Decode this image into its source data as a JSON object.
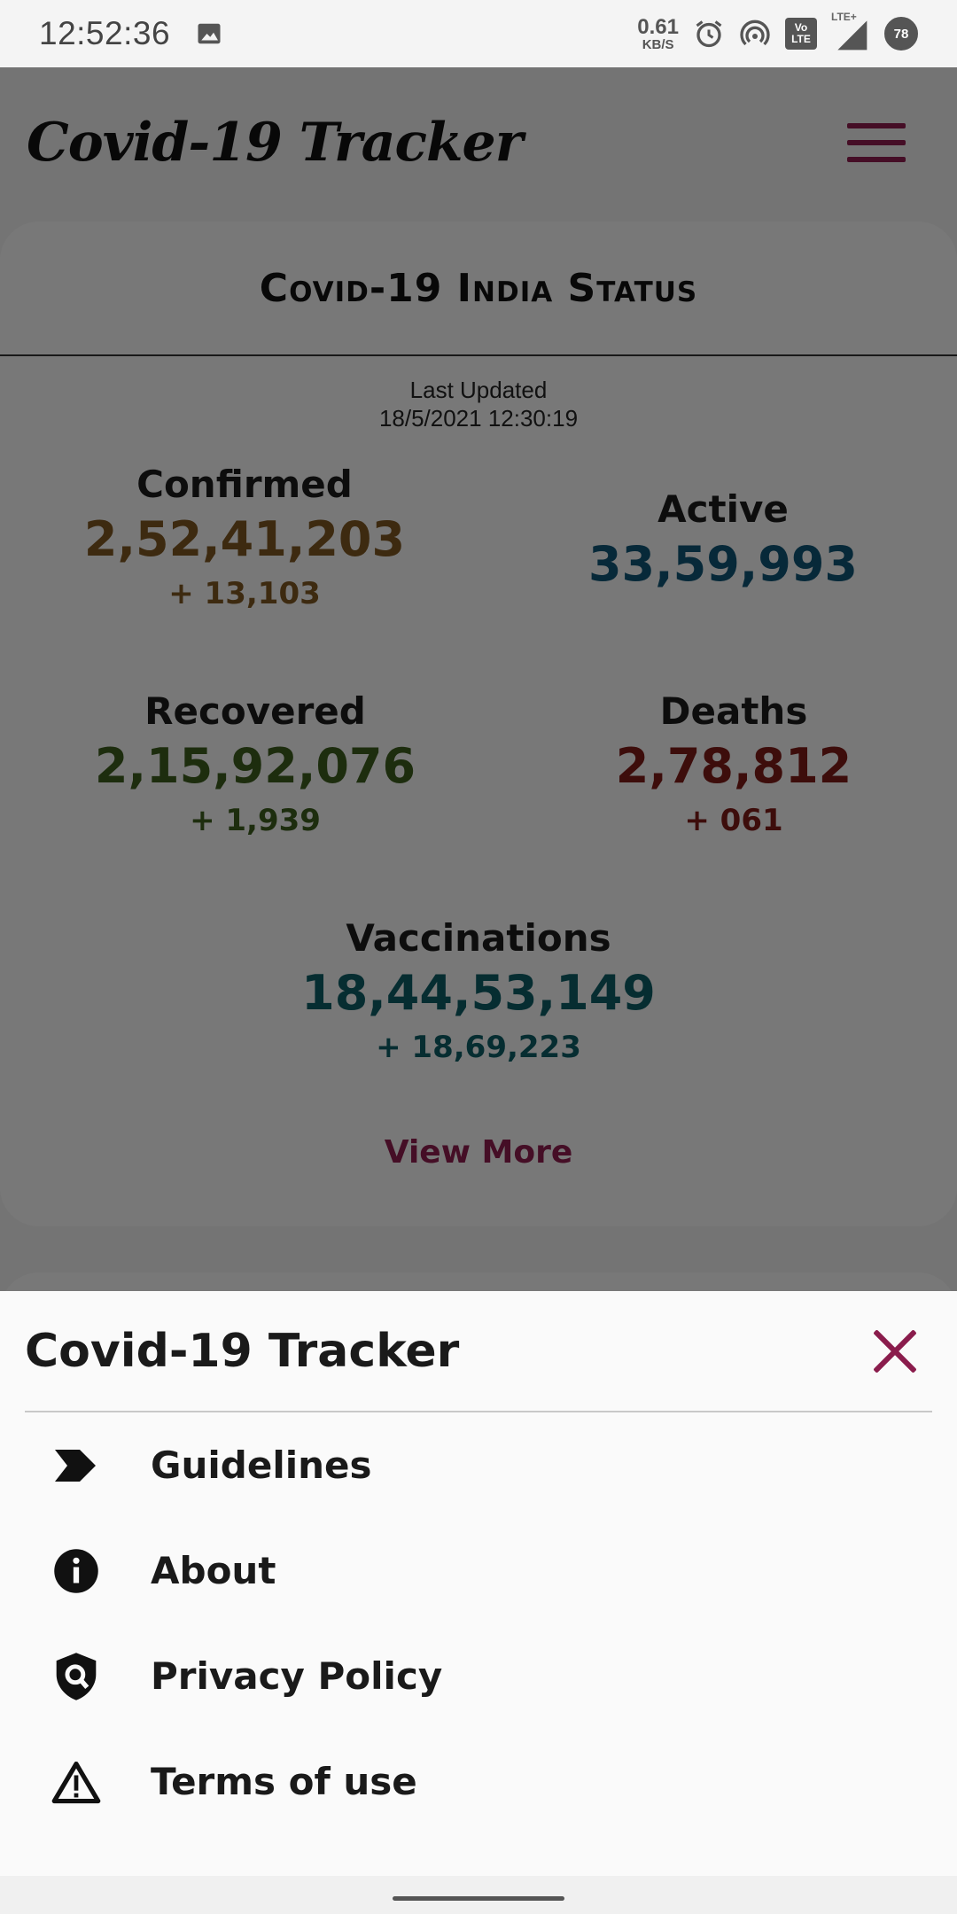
{
  "status_bar": {
    "time": "12:52:36",
    "net_speed": "0.61",
    "net_unit": "KB/S",
    "lte_label": "LTE+",
    "volte_top": "Vo",
    "volte_bottom": "LTE",
    "battery": "78",
    "icons": [
      "image-icon",
      "alarm-icon",
      "hotspot-icon",
      "volte-icon",
      "signal-icon",
      "battery-icon"
    ]
  },
  "app_bar": {
    "title": "Covid-19 Tracker",
    "menu_icon": "hamburger-icon"
  },
  "status_card": {
    "title": "Covid-19 India Status",
    "last_updated_label": "Last Updated",
    "last_updated_value": "18/5/2021 12:30:19",
    "confirmed": {
      "label": "Confirmed",
      "value": "2,52,41,203",
      "delta": "+ 13,103"
    },
    "active": {
      "label": "Active",
      "value": "33,59,993"
    },
    "recovered": {
      "label": "Recovered",
      "value": "2,15,92,076",
      "delta": "+ 1,939"
    },
    "deaths": {
      "label": "Deaths",
      "value": "2,78,812",
      "delta": "+ 061"
    },
    "vaccinations": {
      "label": "Vaccinations",
      "value": "18,44,53,149",
      "delta": "+ 18,69,223"
    },
    "view_more": "View More"
  },
  "colors": {
    "confirmed": "#7a5420",
    "active": "#0f5272",
    "recovered": "#3b5a1d",
    "deaths": "#7a1a17",
    "vaccinations": "#0d5b63",
    "accent": "#8a1c4c"
  },
  "sheet": {
    "title": "Covid-19 Tracker",
    "close_icon": "close-icon",
    "items": [
      {
        "label": "Guidelines",
        "icon": "label-arrow-icon"
      },
      {
        "label": "About",
        "icon": "info-icon"
      },
      {
        "label": "Privacy Policy",
        "icon": "shield-search-icon"
      },
      {
        "label": "Terms of use",
        "icon": "warning-triangle-icon"
      }
    ]
  }
}
